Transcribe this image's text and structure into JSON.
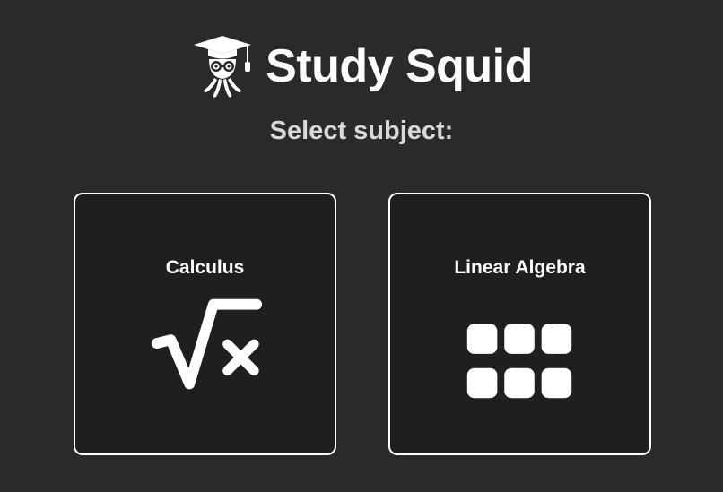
{
  "app": {
    "title": "Study Squid",
    "logo_icon": "squid-graduate-icon"
  },
  "prompt": "Select subject:",
  "subjects": [
    {
      "label": "Calculus",
      "icon": "square-root-x-icon"
    },
    {
      "label": "Linear Algebra",
      "icon": "matrix-grid-icon"
    }
  ],
  "colors": {
    "background": "#2a2a2a",
    "card_background": "#1f1f1f",
    "card_border": "#ffffff",
    "text": "#ffffff",
    "subtitle": "#d9d9d9"
  }
}
